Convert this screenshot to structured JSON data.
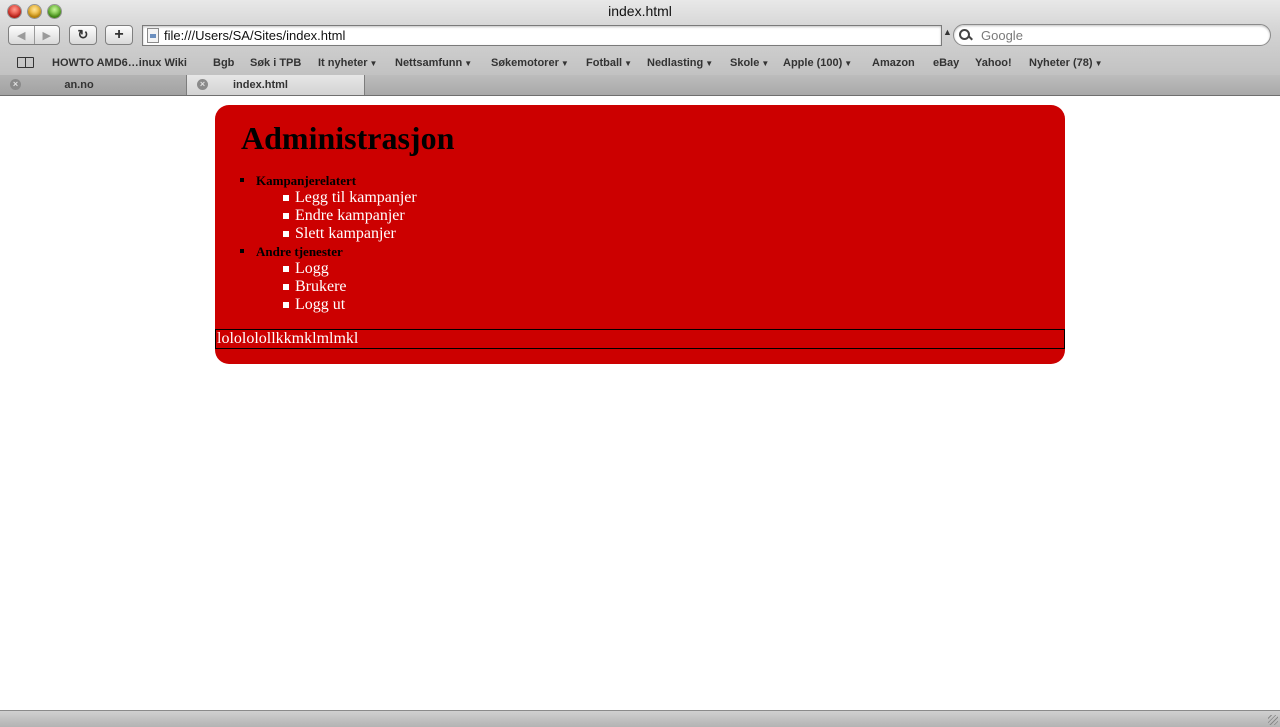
{
  "window": {
    "title": "index.html"
  },
  "toolbar": {
    "back_glyph": "◀",
    "forward_glyph": "▶",
    "reload_glyph": "↻",
    "add_glyph": "+",
    "url": "file:///Users/SA/Sites/index.html",
    "search_placeholder": "Google"
  },
  "bookmarks": [
    {
      "label": "HOWTO AMD6…inux Wiki",
      "menu": false
    },
    {
      "label": "Bgb",
      "menu": false
    },
    {
      "label": "Søk i TPB",
      "menu": false
    },
    {
      "label": "It nyheter",
      "menu": true
    },
    {
      "label": "Nettsamfunn",
      "menu": true
    },
    {
      "label": "Søkemotorer",
      "menu": true
    },
    {
      "label": "Fotball",
      "menu": true
    },
    {
      "label": "Nedlasting",
      "menu": true
    },
    {
      "label": "Skole",
      "menu": true
    },
    {
      "label": "Apple (100)",
      "menu": true
    },
    {
      "label": "Amazon",
      "menu": false
    },
    {
      "label": "eBay",
      "menu": false
    },
    {
      "label": "Yahoo!",
      "menu": false
    },
    {
      "label": "Nyheter (78)",
      "menu": true
    }
  ],
  "tabs": [
    {
      "label": "an.no",
      "active": false
    },
    {
      "label": "index.html",
      "active": true
    }
  ],
  "page": {
    "title": "Administrasjon",
    "sections": [
      {
        "label": "Kampanjerelatert",
        "items": [
          "Legg til kampanjer",
          "Endre kampanjer",
          "Slett kampanjer"
        ]
      },
      {
        "label": "Andre tjenester",
        "items": [
          "Logg",
          "Brukere",
          "Logg ut"
        ]
      }
    ],
    "footer": "lolololollkkmklmlmkl"
  },
  "colors": {
    "panel": "#cc0000",
    "link": "#ffffff",
    "heading": "#000000"
  }
}
